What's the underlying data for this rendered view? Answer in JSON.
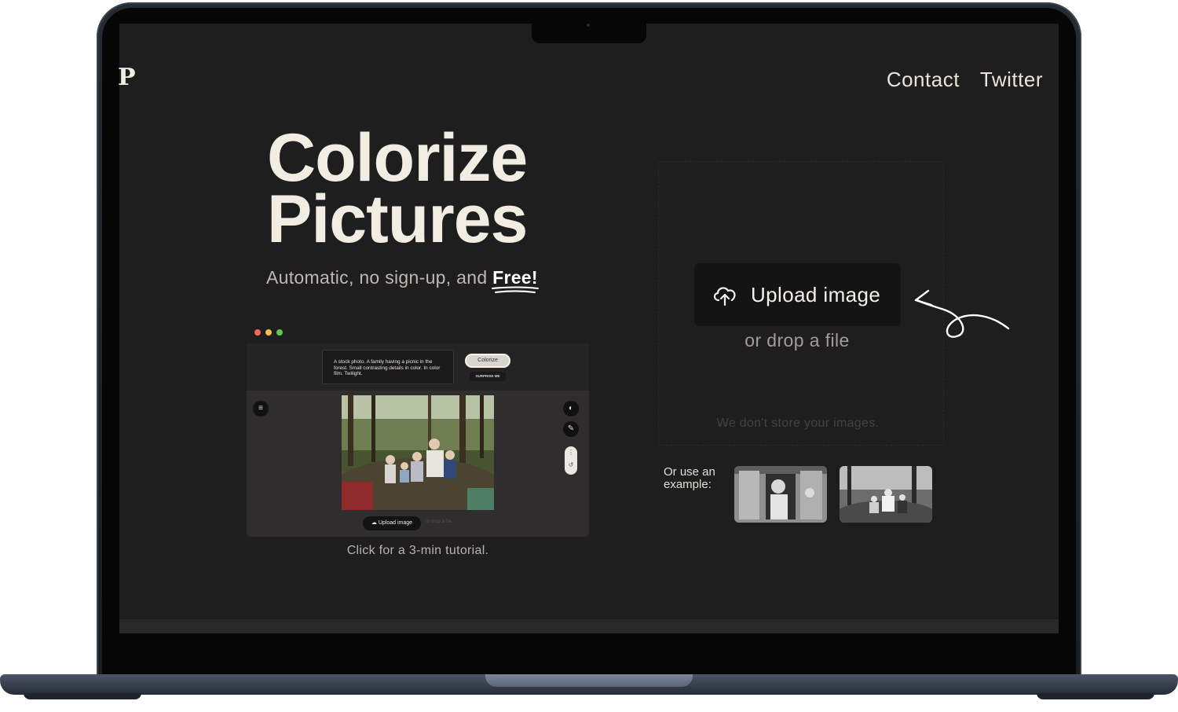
{
  "site": {
    "logo": "P",
    "nav": {
      "contact": "Contact",
      "twitter": "Twitter"
    }
  },
  "hero": {
    "title_line1": "Colorize",
    "title_line2": "Pictures",
    "subtitle_prefix": "Automatic, no sign-up, and ",
    "subtitle_emphasis": "Free!"
  },
  "tutorial_preview": {
    "prompt_text": "A stock photo. A family having a picnic in the forest. Small contrasting details in color. In color film. Twilight.",
    "colorize_label": "Colorize",
    "surprise_label": "SURPRISE ME",
    "upload_label": "Upload image",
    "drop_label": "or drop a file",
    "caption": "Click for a 3-min tutorial."
  },
  "upload": {
    "button_label": "Upload image",
    "drop_text": "or drop a file",
    "privacy_note": "We don't store your images."
  },
  "examples": {
    "label": "Or use an example:"
  },
  "colors": {
    "screen_bg": "#1f1e1e",
    "text_light": "#f1ede3",
    "button_bg": "#151414"
  },
  "icons": {
    "upload": "cloud-upload-icon",
    "menu": "menu-icon",
    "palette": "palette-icon",
    "pencil": "pencil-icon",
    "undo": "undo-icon",
    "arrow": "hand-drawn-arrow-icon"
  }
}
